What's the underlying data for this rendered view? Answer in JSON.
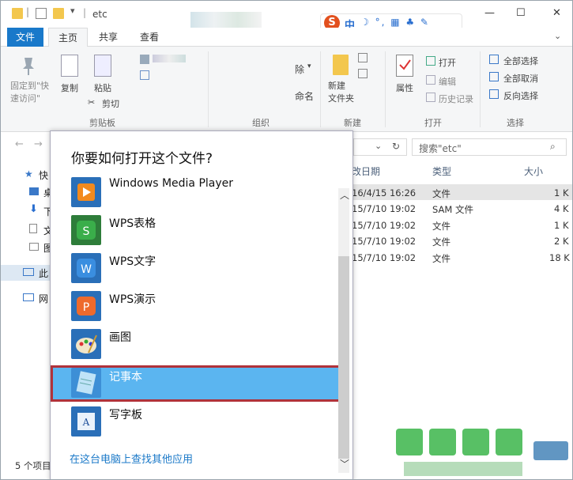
{
  "window": {
    "path_label": "etc",
    "minimize": "—",
    "maximize": "☐",
    "close": "✕"
  },
  "sogou": {
    "brand": "S",
    "lang": "中",
    "icons": "☽ °, ▦ ♣ ✎"
  },
  "ribbon_tabs": [
    "文件",
    "主页",
    "共享",
    "查看"
  ],
  "ribbon": {
    "pin_label": "固定到\"快\n速访问\"",
    "copy": "复制",
    "paste": "粘贴",
    "cut": "剪切",
    "clipboard": "剪贴板",
    "delete_partial": "除",
    "rename_partial": "命名",
    "organize": "组织",
    "new_folder": "新建\n文件夹",
    "new_group": "新建",
    "properties": "属性",
    "open": "打开",
    "edit": "编辑",
    "history": "历史记录",
    "open_group": "打开",
    "select_all": "全部选择",
    "select_none": "全部取消",
    "invert": "反向选择",
    "select_group": "选择"
  },
  "address": {
    "search_placeholder": "搜索\"etc\""
  },
  "columns": {
    "date": "改日期",
    "type": "类型",
    "size": "大小"
  },
  "files": [
    {
      "date": "16/4/15 16:26",
      "type": "文件",
      "size": "1 K"
    },
    {
      "date": "15/7/10 19:02",
      "type": "SAM 文件",
      "size": "4 K"
    },
    {
      "date": "15/7/10 19:02",
      "type": "文件",
      "size": "1 K"
    },
    {
      "date": "15/7/10 19:02",
      "type": "文件",
      "size": "2 K"
    },
    {
      "date": "15/7/10 19:02",
      "type": "文件",
      "size": "18 K"
    }
  ],
  "nav": [
    "快",
    "桌",
    "下",
    "文",
    "图",
    "此",
    "网"
  ],
  "status": "5 个项目",
  "dialog": {
    "title": "你要如何打开这个文件?",
    "apps": [
      "Windows Media Player",
      "WPS表格",
      "WPS文字",
      "WPS演示",
      "画图",
      "记事本",
      "写字板"
    ],
    "more_link": "在这台电脑上查找其他应用"
  },
  "colors": {
    "accent": "#1979ca",
    "selected": "#5bb5f0",
    "highlight_border": "#b0323a"
  }
}
